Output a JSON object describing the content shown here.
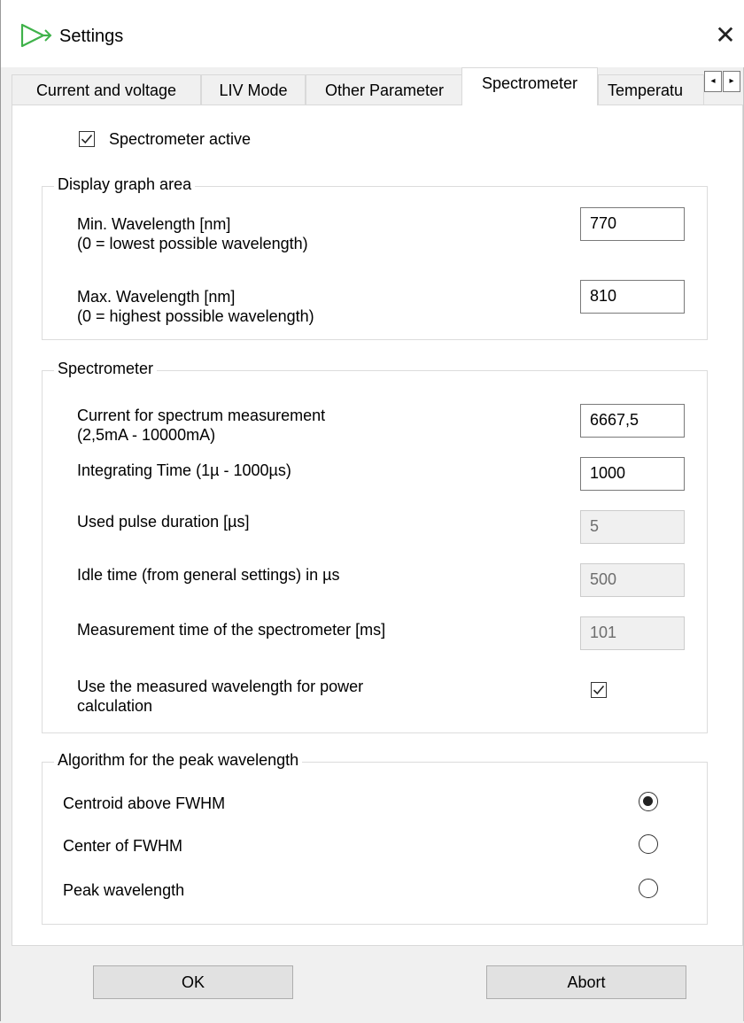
{
  "window": {
    "title": "Settings",
    "close_glyph": "✕"
  },
  "tabs": [
    {
      "label": "Current and voltage"
    },
    {
      "label": "LIV Mode"
    },
    {
      "label": "Other Parameter"
    },
    {
      "label": "Spectrometer",
      "active": true
    },
    {
      "label": "Temperatu"
    }
  ],
  "tab_scroll": {
    "left": "◂",
    "right": "▸"
  },
  "spectrometer_active": {
    "label": "Spectrometer active",
    "checked": true
  },
  "display_graph_area": {
    "title": "Display graph area",
    "min_wavelength": {
      "label_line1": "Min. Wavelength [nm]",
      "label_line2": "(0 = lowest possible wavelength)",
      "value": "770"
    },
    "max_wavelength": {
      "label_line1": "Max. Wavelength [nm]",
      "label_line2": "(0 = highest possible wavelength)",
      "value": "810"
    }
  },
  "spectrometer": {
    "title": "Spectrometer",
    "current": {
      "label_line1": "Current for spectrum measurement",
      "label_line2": "(2,5mA - 10000mA)",
      "value": "6667,5"
    },
    "integrating_time": {
      "label": "Integrating Time (1µ - 1000µs)",
      "value": "1000"
    },
    "pulse_duration": {
      "label": "Used pulse duration [µs]",
      "value": "5"
    },
    "idle_time": {
      "label": "Idle time (from general settings) in µs",
      "value": "500"
    },
    "measurement_time": {
      "label": "Measurement time of the spectrometer [ms]",
      "value": "101"
    },
    "use_measured_wavelength": {
      "label_line1": "Use the measured wavelength for power",
      "label_line2": "calculation",
      "checked": true
    }
  },
  "algorithm": {
    "title": "Algorithm for the peak wavelength",
    "options": [
      {
        "label": "Centroid above FWHM",
        "selected": true
      },
      {
        "label": "Center of FWHM",
        "selected": false
      },
      {
        "label": "Peak wavelength",
        "selected": false
      }
    ]
  },
  "buttons": {
    "ok": "OK",
    "abort": "Abort"
  },
  "colors": {
    "logo_green": "#3fb24a"
  }
}
